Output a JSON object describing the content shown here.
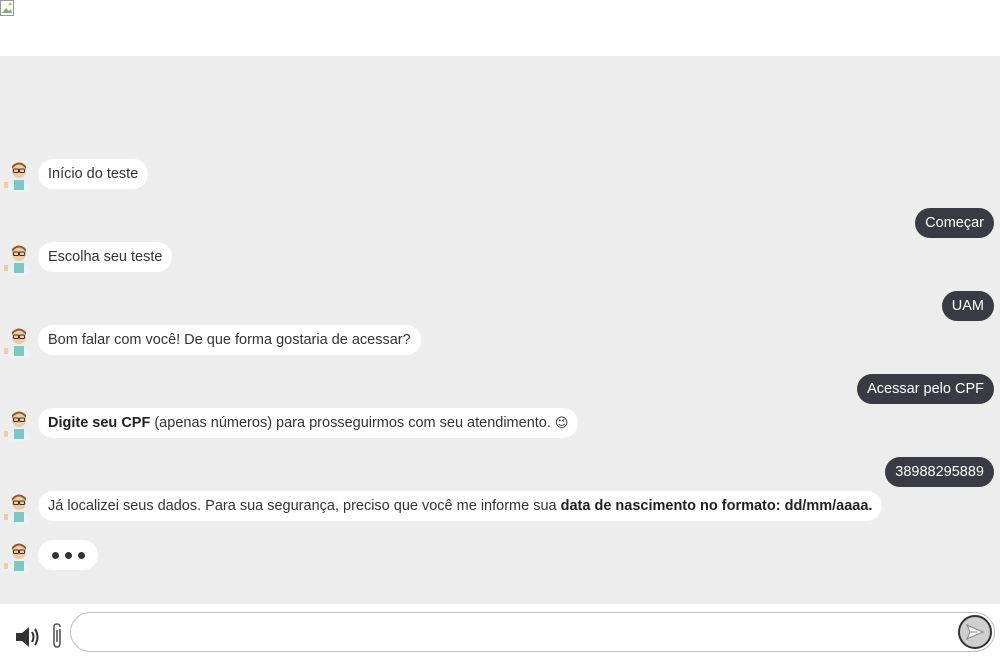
{
  "messages": [
    {
      "from": "bot",
      "text": "Início do teste"
    },
    {
      "from": "user",
      "text": "Começar"
    },
    {
      "from": "bot",
      "text": "Escolha seu teste"
    },
    {
      "from": "user",
      "text": "UAM"
    },
    {
      "from": "bot",
      "text": "Bom falar com você! De que forma gostaria de acessar?"
    },
    {
      "from": "user",
      "text": "Acessar pelo CPF"
    },
    {
      "from": "bot",
      "bold": "Digite seu CPF",
      "text": " (apenas números) para prosseguirmos com seu atendimento. ",
      "emoji": "😉"
    },
    {
      "from": "user",
      "text": "38988295889"
    },
    {
      "from": "bot",
      "text": "Já localizei seus dados. Para sua segurança, preciso que você me informe sua ",
      "bold_end": "data de nascimento no formato: dd/mm/aaaa."
    }
  ],
  "input": {
    "placeholder": "",
    "value": ""
  },
  "icons": {
    "sound": "speaker-icon",
    "attach": "paperclip-icon",
    "send": "send-icon",
    "avatar": "bot-avatar-icon"
  },
  "colors": {
    "chat_bg": "#ededed",
    "user_bubble": "#3a3a45",
    "bot_bubble": "#ffffff"
  }
}
